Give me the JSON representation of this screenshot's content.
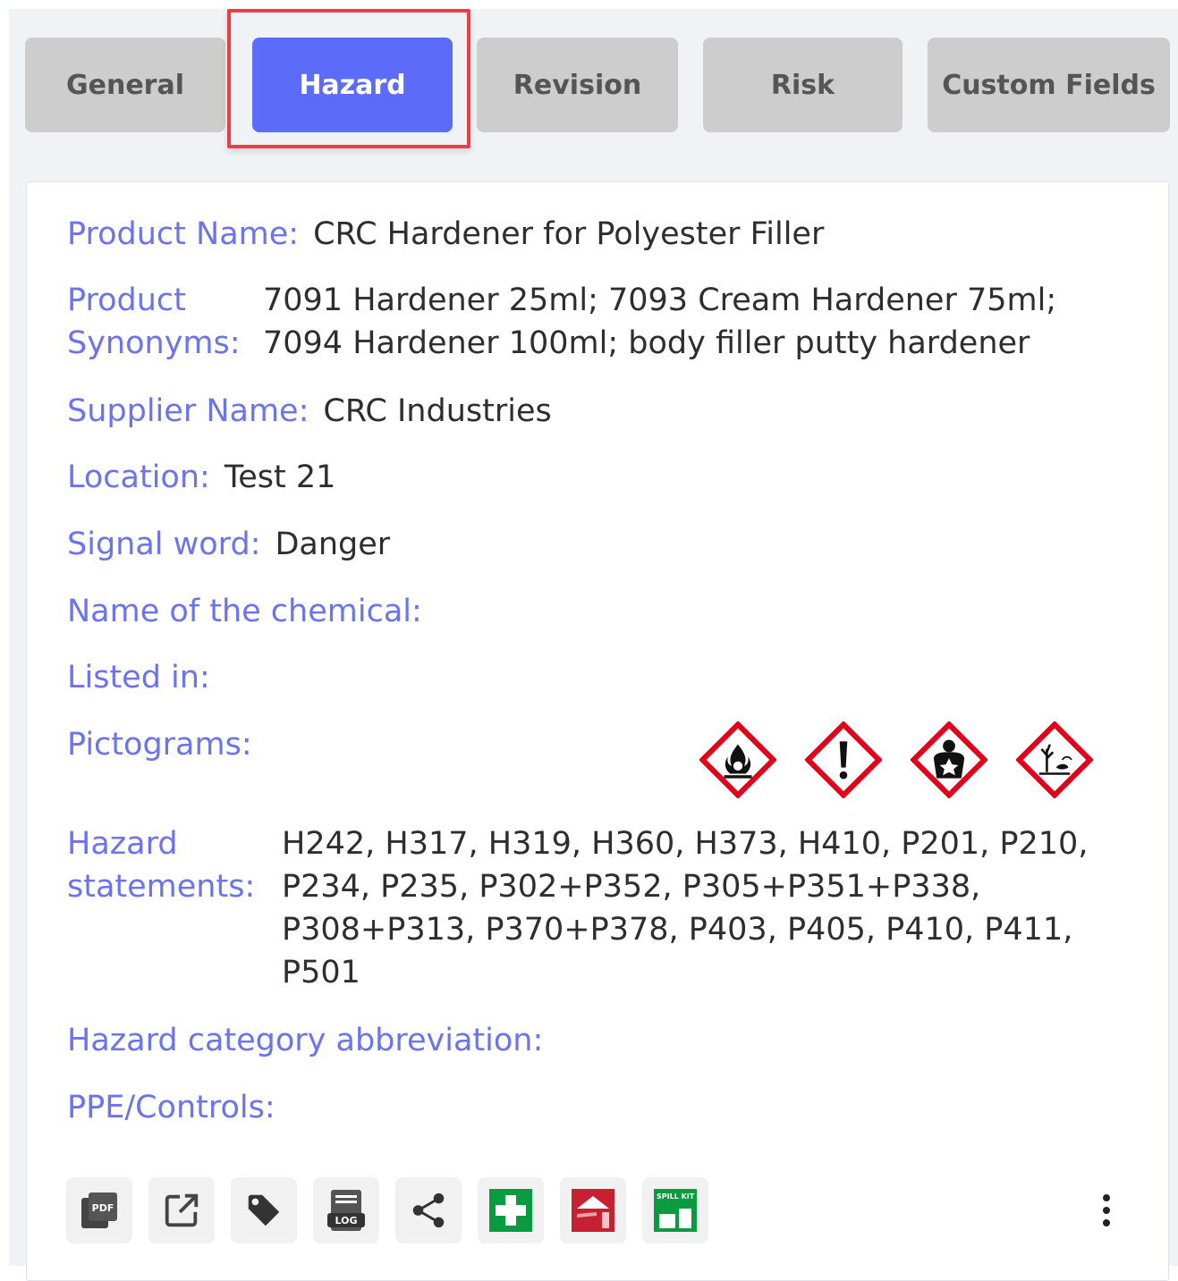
{
  "tabs": [
    {
      "label": "General"
    },
    {
      "label": "Hazard",
      "active": true
    },
    {
      "label": "Revision"
    },
    {
      "label": "Risk"
    },
    {
      "label": "Custom Fields"
    }
  ],
  "fields": {
    "product_name": {
      "label": "Product Name:",
      "value": "CRC Hardener for Polyester Filler"
    },
    "product_synonyms": {
      "label_line1": "Product",
      "label_line2": "Synonyms:",
      "value_line1": "7091 Hardener 25ml; 7093 Cream Hardener 75ml;",
      "value_line2": "7094 Hardener 100ml; body filler putty hardener"
    },
    "supplier_name": {
      "label": "Supplier Name:",
      "value": "CRC Industries"
    },
    "location": {
      "label": "Location:",
      "value": "Test 21"
    },
    "signal_word": {
      "label": "Signal word:",
      "value": "Danger"
    },
    "chemical_name": {
      "label": "Name of the chemical:",
      "value": ""
    },
    "listed_in": {
      "label": "Listed in:",
      "value": ""
    },
    "pictograms": {
      "label": "Pictograms:"
    },
    "hazard_statements": {
      "label_line1": "Hazard",
      "label_line2": "statements:",
      "value_lines": [
        "H242, H317, H319, H360, H373, H410, P201, P210,",
        "P234, P235, P302+P352, P305+P351+P338,",
        "P308+P313, P370+P378, P403, P405, P410, P411,",
        "P501"
      ]
    },
    "hazard_category": {
      "label": "Hazard category abbreviation:",
      "value": ""
    },
    "ppe_controls": {
      "label": "PPE/Controls:",
      "value": ""
    }
  },
  "pictograms": [
    "flame-over-circle-icon",
    "exclamation-mark-icon",
    "health-hazard-icon",
    "environment-icon"
  ],
  "toolbar": [
    {
      "icon": "pdf-icon",
      "text": "PDF"
    },
    {
      "icon": "open-external-icon"
    },
    {
      "icon": "tag-icon"
    },
    {
      "icon": "log-icon",
      "text": "LOG"
    },
    {
      "icon": "share-icon"
    },
    {
      "icon": "first-aid-icon"
    },
    {
      "icon": "fire-extinguisher-sign-icon"
    },
    {
      "icon": "spill-kit-icon",
      "text": "SPILL KIT"
    }
  ],
  "colors": {
    "accent": "#5d6bfa",
    "label": "#6b73f2",
    "highlight": "#ea3f47",
    "ghs_red": "#e3001b",
    "first_aid_green": "#0a9a3f",
    "fire_red": "#c62032"
  }
}
